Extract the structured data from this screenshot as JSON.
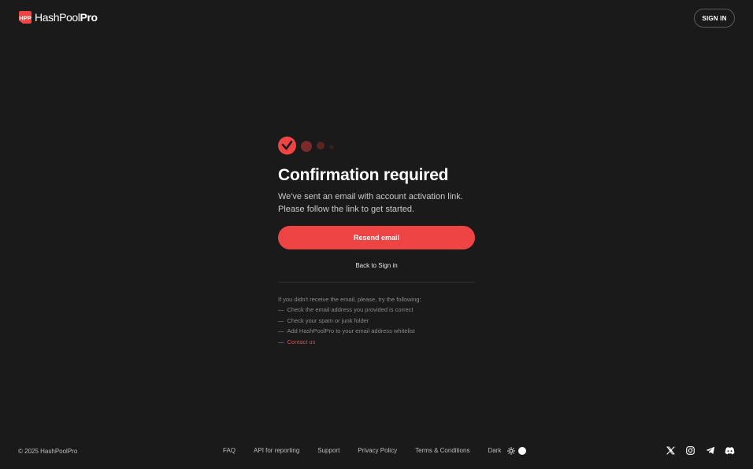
{
  "header": {
    "logo_light": "HashPool",
    "logo_bold": "Pro",
    "logo_mark_text": "HPP",
    "signin_label": "SIGN IN"
  },
  "main": {
    "title": "Confirmation required",
    "desc_line1": "We've sent an email with account activation link.",
    "desc_line2": "Please follow the link to get started.",
    "resend_label": "Resend email",
    "back_label": "Back to Sign in",
    "help_intro": "If you didn't receive the email, please, try the following:",
    "help_items": [
      "Check the email address you provided is correct",
      "Check your spam or junk folder",
      "Add HashPoolPro to your email address whitelist",
      "Contact us"
    ],
    "dash": "—"
  },
  "footer": {
    "copyright": "© 2025 HashPoolPro",
    "links": {
      "faq": "FAQ",
      "api": "API for reporting",
      "support": "Support",
      "privacy": "Privacy Policy",
      "terms": "Terms & Conditions"
    },
    "theme_label": "Dark"
  },
  "colors": {
    "background": "#1a1a1a",
    "accent": "#ef4444",
    "muted_text": "#8a8a8a"
  },
  "icons": [
    "check-circle-icon",
    "sun-icon",
    "x-twitter-icon",
    "instagram-icon",
    "telegram-icon",
    "discord-icon"
  ]
}
